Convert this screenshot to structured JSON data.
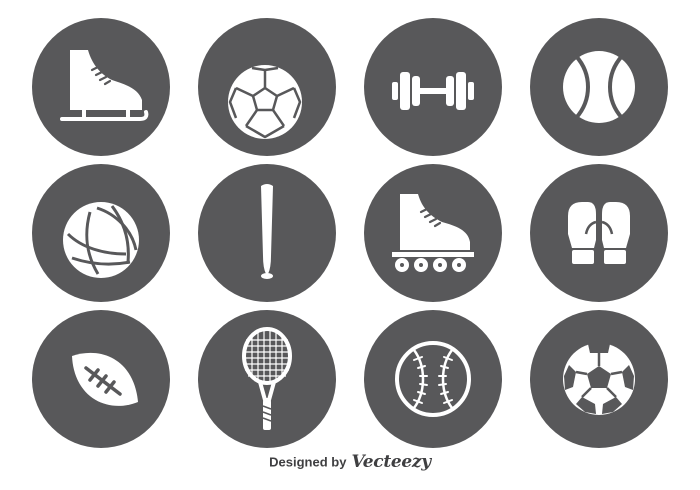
{
  "icons": [
    {
      "name": "ice-skate-icon"
    },
    {
      "name": "handball-icon"
    },
    {
      "name": "dumbbell-icon"
    },
    {
      "name": "tennis-ball-icon"
    },
    {
      "name": "volleyball-icon"
    },
    {
      "name": "baseball-bat-icon"
    },
    {
      "name": "roller-skate-icon"
    },
    {
      "name": "boxing-gloves-icon"
    },
    {
      "name": "american-football-icon"
    },
    {
      "name": "tennis-racket-icon"
    },
    {
      "name": "baseball-icon"
    },
    {
      "name": "soccer-ball-icon"
    }
  ],
  "colors": {
    "circle": "#58585a",
    "glyph": "#ffffff",
    "credit_text": "#3f3f41"
  },
  "credit": {
    "prefix": "Designed by",
    "brand": "Vecteezy"
  }
}
